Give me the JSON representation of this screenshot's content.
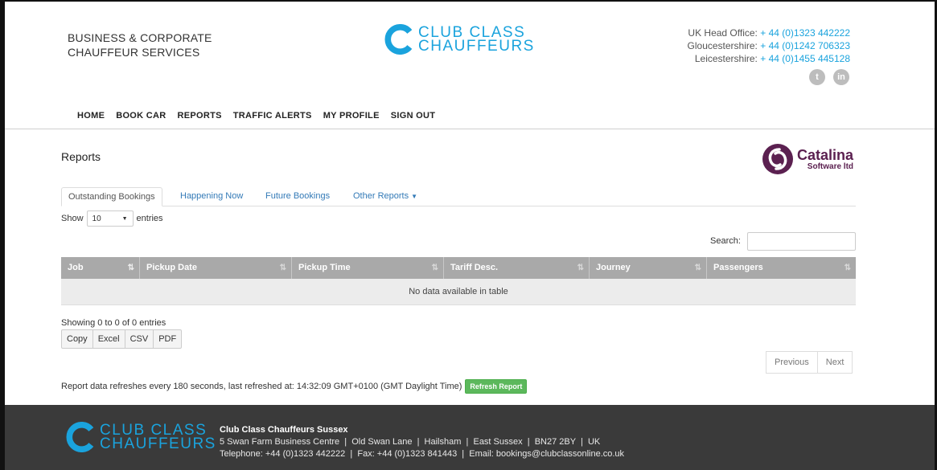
{
  "header": {
    "tagline_line1": "BUSINESS & CORPORATE",
    "tagline_line2": "CHAUFFEUR SERVICES",
    "logo_line1": "CLUB CLASS",
    "logo_line2": "CHAUFFEURS",
    "contacts": [
      {
        "label": "UK Head Office:",
        "phone": "+ 44 (0)1323 442222"
      },
      {
        "label": "Gloucestershire:",
        "phone": "+ 44 (0)1242 706323"
      },
      {
        "label": "Leicestershire:",
        "phone": "+ 44 (0)1455 445128"
      }
    ],
    "social": {
      "twitter_glyph": "t",
      "linkedin_glyph": "in"
    }
  },
  "nav": [
    "HOME",
    "BOOK CAR",
    "REPORTS",
    "TRAFFIC ALERTS",
    "MY PROFILE",
    "SIGN OUT"
  ],
  "page": {
    "title": "Reports",
    "partner_logo_line1": "Catalina",
    "partner_logo_line2": "Software ltd"
  },
  "tabs": [
    "Outstanding Bookings",
    "Happening Now",
    "Future Bookings",
    "Other Reports"
  ],
  "table_controls": {
    "show_label": "Show",
    "entries_value": "10",
    "entries_label": "entries",
    "search_label": "Search:",
    "search_value": ""
  },
  "table": {
    "columns": [
      "Job",
      "Pickup Date",
      "Pickup Time",
      "Tariff Desc.",
      "Journey",
      "Passengers"
    ],
    "empty_message": "No data available in table",
    "info": "Showing 0 to 0 of 0 entries"
  },
  "export_buttons": [
    "Copy",
    "Excel",
    "CSV",
    "PDF"
  ],
  "pager": {
    "previous": "Previous",
    "next": "Next"
  },
  "refresh": {
    "text": "Report data refreshes every 180 seconds, last refreshed at: 14:32:09 GMT+0100 (GMT Daylight Time)",
    "button": "Refresh Report"
  },
  "footer": {
    "logo_line1": "CLUB CLASS",
    "logo_line2": "CHAUFFEURS",
    "title": "Club Class Chauffeurs Sussex",
    "address": "5 Swan Farm Business Centre  |  Old Swan Lane  |  Hailsham  |  East Sussex  |  BN27 2BY  |  UK",
    "contact": "Telephone: +44 (0)1323 442222  |  Fax: +44 (0)1323 841443  |  Email: bookings@clubclassonline.co.uk"
  },
  "colors": {
    "brand_blue": "#1aa3dd",
    "catalina_purple": "#5b2050",
    "refresh_green": "#5cb85c",
    "footer_bg": "#3a3a3a"
  }
}
